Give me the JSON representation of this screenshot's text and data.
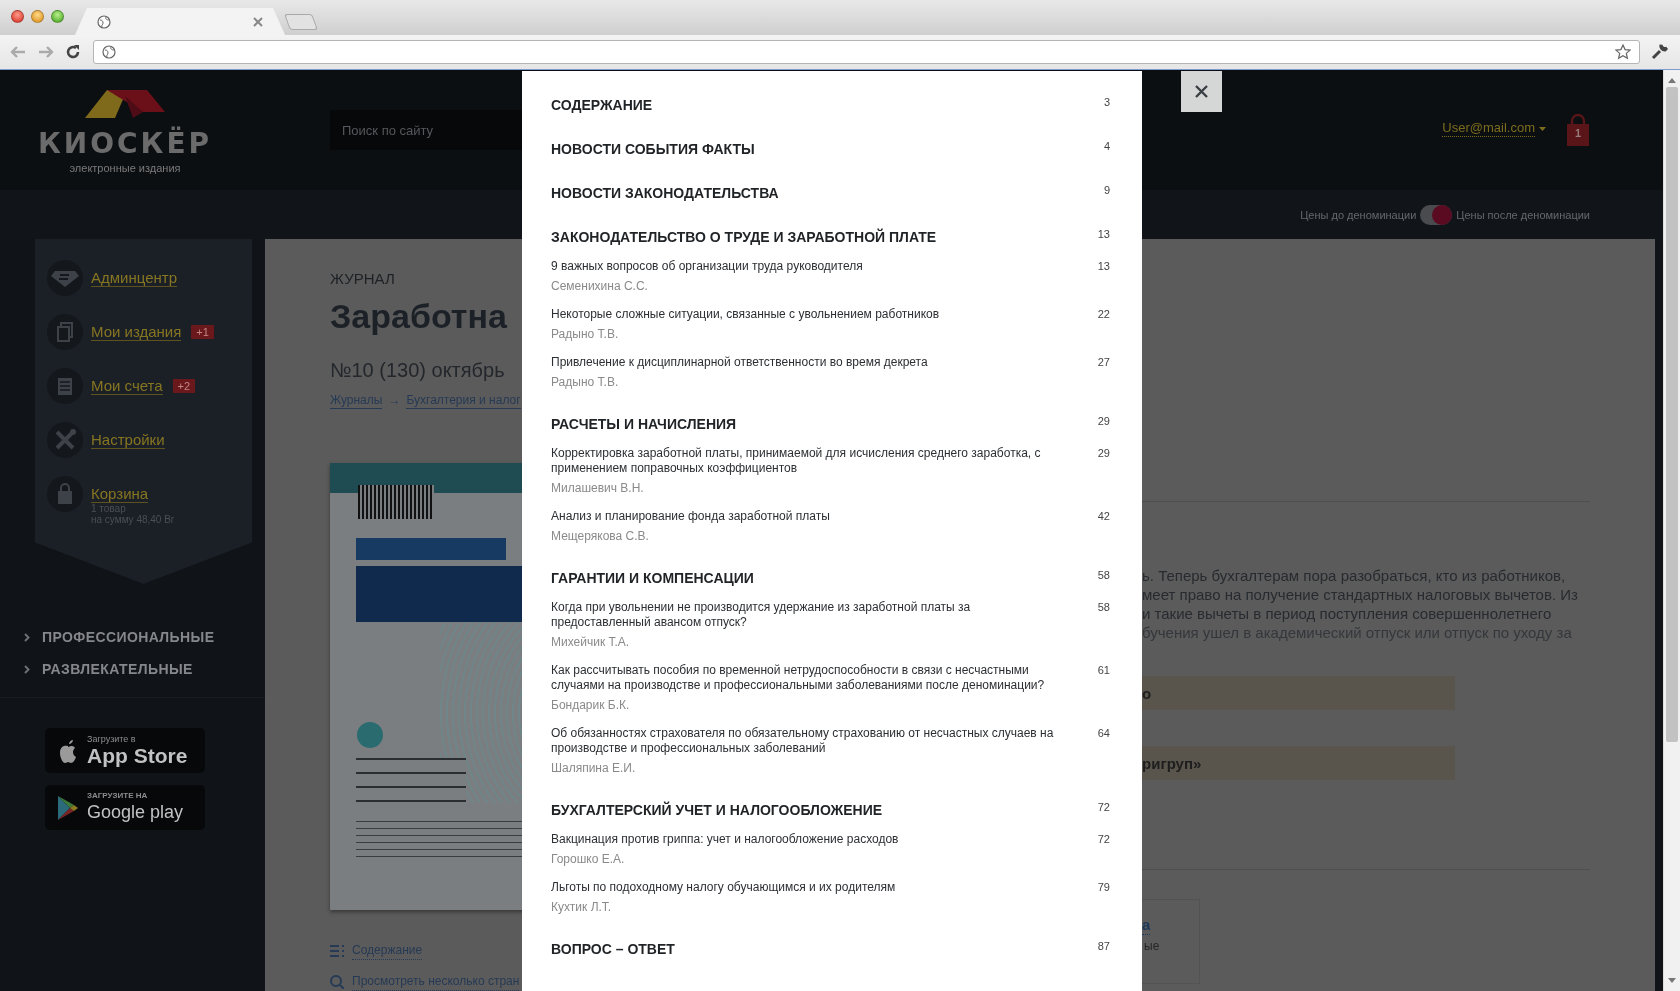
{
  "header": {
    "logo_name": "КИОСКЁР",
    "logo_tagline": "электронные издания",
    "search": {
      "placeholder": "Поиск по сайту"
    },
    "user_email": "User@mail.com",
    "cart_count": "1"
  },
  "price_toggle": {
    "label_before": "Цены до деноминации",
    "label_after": "Цены после деноминации",
    "on": true
  },
  "sidebar": {
    "items": [
      {
        "kind": "admin",
        "label": "Админцентр"
      },
      {
        "kind": "editions",
        "label": "Мои издания",
        "badge": "+1"
      },
      {
        "kind": "bills",
        "label": "Мои счета",
        "badge": "+2"
      },
      {
        "kind": "settings",
        "label": "Настройки"
      },
      {
        "kind": "cart",
        "label": "Корзина",
        "details": [
          "1 товар",
          "на сумму 48,40 Br"
        ]
      }
    ],
    "categories": [
      {
        "label": "ПРОФЕССИОНАЛЬНЫЕ"
      },
      {
        "label": "РАЗВЛЕКАТЕЛЬНЫЕ"
      }
    ],
    "app_badges": [
      {
        "kind": "appstore",
        "caption": "Загрузите в",
        "store": "App Store"
      },
      {
        "kind": "googleplay",
        "caption": "ЗАГРУЗИТЕ НА",
        "store": "Google play"
      }
    ]
  },
  "publication": {
    "type_label": "ЖУРНАЛ",
    "title": "Заработна",
    "issue": "№10 (130) октябрь",
    "breadcrumbs": [
      "Журналы",
      "Бухгалтерия и налог"
    ],
    "breadcrumb_separator": "→",
    "links": [
      {
        "kind": "contents",
        "label": "Содержание"
      },
      {
        "kind": "preview",
        "label": "Просмотреть несколько стран"
      }
    ]
  },
  "article_preview": {
    "lines": [
      "ь. Теперь бухгалтерам пора разобраться, кто из работников,",
      "меет право на получение стандартных налоговых вычетов. Из",
      "и такие вычеты в период поступления совершеннолетнего",
      "бучения ушел в академический отпуск или отпуск по уходу за"
    ],
    "highlights": [
      "о",
      "ригруп»"
    ],
    "card": {
      "title": "а",
      "subtitle": "ые"
    }
  },
  "toc": {
    "sections": [
      {
        "title": "СОДЕРЖАНИЕ",
        "page": "3"
      },
      {
        "title": "НОВОСТИ СОБЫТИЯ ФАКТЫ",
        "page": "4"
      },
      {
        "title": "НОВОСТИ ЗАКОНОДАТЕЛЬСТВА",
        "page": "9"
      },
      {
        "title": "ЗАКОНОДАТЕЛЬСТВО О ТРУДЕ И ЗАРАБОТНОЙ ПЛАТЕ",
        "page": "13",
        "articles": [
          {
            "title": "9 важных вопросов об организации труда руководителя",
            "author": "Семенихина С.С.",
            "page": "13"
          },
          {
            "title": "Некоторые сложные ситуации, связанные с увольнением работников",
            "author": "Радыно Т.В.",
            "page": "22"
          },
          {
            "title": "Привлечение к дисциплинарной ответственности во время декрета",
            "author": "Радыно Т.В.",
            "page": "27"
          }
        ]
      },
      {
        "title": "РАСЧЕТЫ И НАЧИСЛЕНИЯ",
        "page": "29",
        "articles": [
          {
            "title": "Корректировка заработной платы, принимаемой для исчисления среднего заработка, с применением поправочных коэффициентов",
            "author": "Милашевич В.Н.",
            "page": "29"
          },
          {
            "title": "Анализ и планирование фонда заработной платы",
            "author": "Мещерякова С.В.",
            "page": "42"
          }
        ]
      },
      {
        "title": "ГАРАНТИИ И КОМПЕНСАЦИИ",
        "page": "58",
        "articles": [
          {
            "title": "Когда при увольнении не производится удержание из заработной платы за предоставленный авансом отпуск?",
            "author": "Михейчик Т.А.",
            "page": "58"
          },
          {
            "title": "Как рассчитывать пособия по временной нетрудоспособности в связи с несчастными случаями на производстве и профессиональными заболеваниями после деноминации?",
            "author": "Бондарик Б.К.",
            "page": "61"
          },
          {
            "title": "Об обязанностях страхователя по обязательному страхованию от несчастных случаев на производстве и профессиональных заболеваний",
            "author": "Шаляпина Е.И.",
            "page": "64"
          }
        ]
      },
      {
        "title": "БУХГАЛТЕРСКИЙ УЧЕТ И НАЛОГООБЛОЖЕНИЕ",
        "page": "72",
        "articles": [
          {
            "title": "Вакцинация против гриппа: учет и налогообложение расходов",
            "author": "Горошко Е.А.",
            "page": "72"
          },
          {
            "title": "Льготы по подоходному налогу обучающимся и их родителям",
            "author": "Кухтик Л.Т.",
            "page": "79"
          }
        ]
      },
      {
        "title": "ВОПРОС – ОТВЕТ",
        "page": "87"
      }
    ]
  }
}
